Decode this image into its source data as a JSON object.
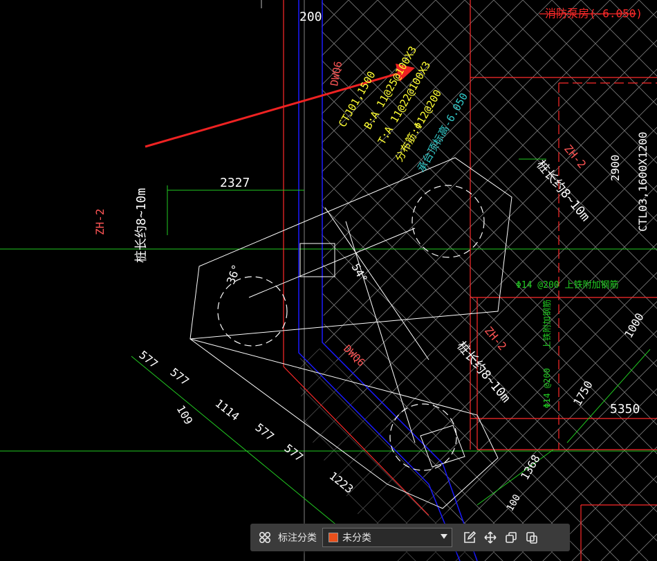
{
  "drawing": {
    "title_room": "消防泵房(-6.050)",
    "dim_200": "200",
    "dim_2327": "2327",
    "dim_2900": "2900",
    "dim_1000": "1000",
    "dim_1750": "1750",
    "dim_5350": "5350",
    "dim_1368": "1368",
    "dim_577a": "577",
    "dim_577b": "577",
    "dim_577c": "577",
    "dim_577d": "577",
    "dim_1114": "1114",
    "dim_1223": "1223",
    "dim_109": "109",
    "dim_100": "100",
    "angle_36": "36°",
    "angle_54": "54°",
    "dwq_top": "DWQ6",
    "dwq_bottom": "DWQ6",
    "zh_left": "ZH-2",
    "zh_right": "ZH-2",
    "zh_mid": "ZH-2",
    "pile_left": "桩长约8~10m",
    "pile_right": "桩长约8~10m",
    "pile_mid": "桩长约8~10m",
    "ctj_line1": "CTJ01,1500",
    "ctj_line2": "B:A 11@25@100X3",
    "ctj_line3": "T:A 11@22@100X3",
    "ctj_line4": "分布筋:Φ12@200",
    "ctj_line5": "承台顶标高-6.050",
    "ctl_label": "CTL03,1600X1200",
    "rebar_top": "Φ14 @200  上铁附加钢筋",
    "rebar_vert1": "上铁附加钢筋",
    "rebar_vert2": "Φ14 @200"
  },
  "toolbar": {
    "category_label": "标注分类",
    "select_value": "未分类",
    "swatch_color": "#e8501c"
  },
  "colors": {
    "white": "#ffffff",
    "red": "#ff2a2a",
    "green": "#22cc22",
    "blue": "#1a1aff",
    "yellow": "#ffff33",
    "cyan": "#33cccc",
    "arrow": "#ee2222"
  }
}
